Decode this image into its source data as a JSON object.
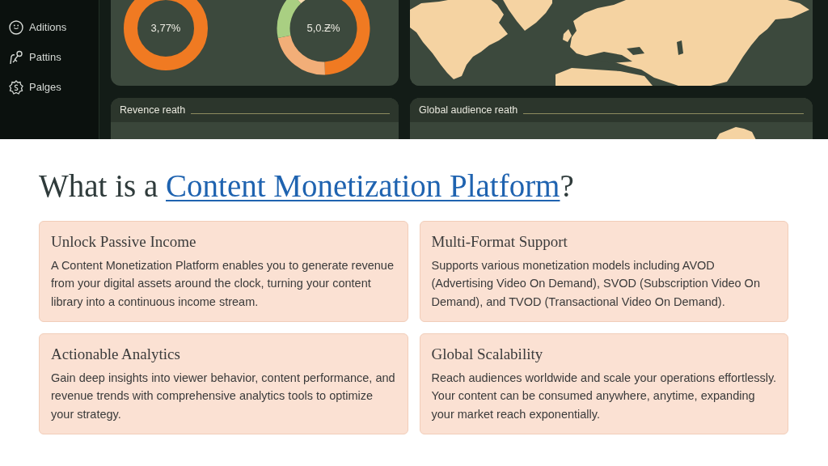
{
  "dashboard_preview": {
    "sidebar": {
      "items": [
        {
          "label": "Aditions"
        },
        {
          "label": "Pattins"
        },
        {
          "label": "Palges"
        }
      ]
    },
    "donuts": [
      {
        "label": "3,77%"
      },
      {
        "label": "5,0.Ƶ%"
      }
    ],
    "panels": [
      {
        "title": "Revence reath"
      },
      {
        "title": "Global audience reath"
      }
    ]
  },
  "heading": {
    "text": "What is a ",
    "link": "Content Monetization Platform",
    "suffix": "?"
  },
  "cards": [
    {
      "title": "Unlock Passive Income",
      "body": "A Content Monetization Platform enables you to generate revenue from your digital assets around the clock, turning your content library into a continuous income stream."
    },
    {
      "title": "Multi-Format Support",
      "body": "Supports various monetization models including AVOD (Advertising Video On Demand), SVOD (Subscription Video On Demand), and TVOD (Transactional Video On Demand)."
    },
    {
      "title": "Actionable Analytics",
      "body": "Gain deep insights into viewer behavior, content performance, and revenue trends with comprehensive analytics tools to optimize your strategy."
    },
    {
      "title": "Global Scalability",
      "body": "Reach audiences worldwide and scale your operations effortlessly. Your content can be consumed anywhere, anytime, expanding your market reach exponentially."
    }
  ]
}
